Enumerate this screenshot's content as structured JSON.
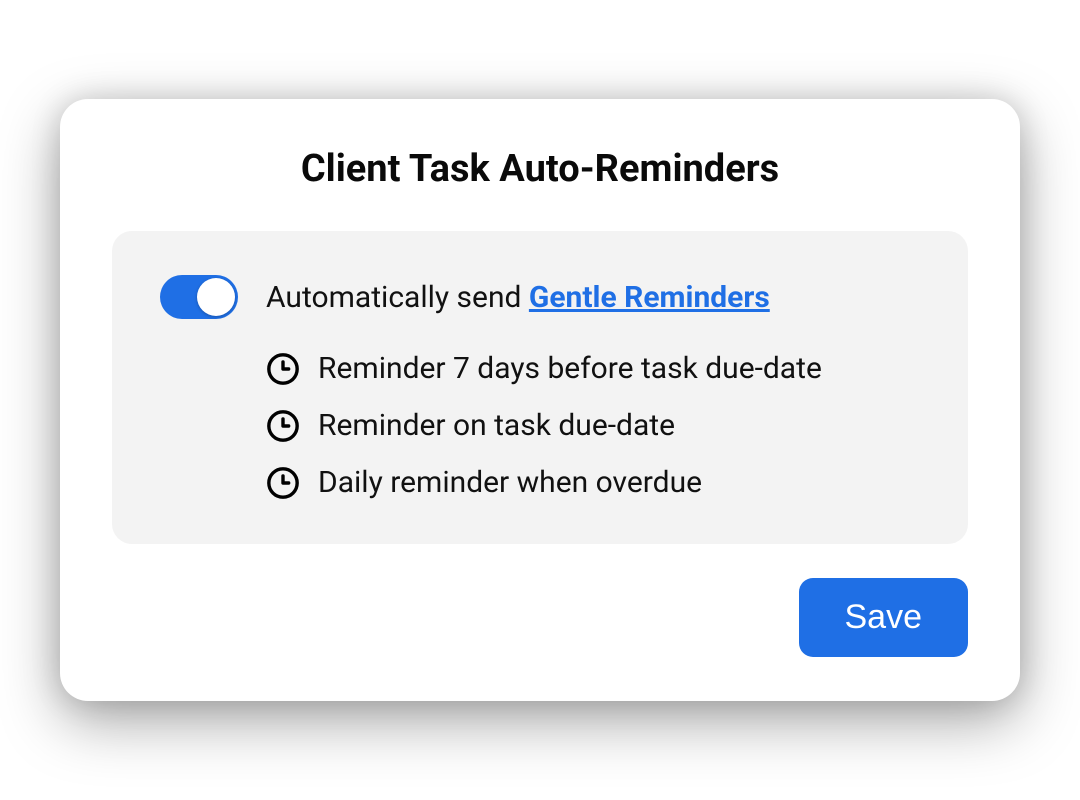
{
  "title": "Client Task Auto-Reminders",
  "toggle": {
    "on": true,
    "label_prefix": "Automatically send ",
    "link_text": "Gentle Reminders"
  },
  "reminders": [
    "Reminder 7 days before task due-date",
    "Reminder on task due-date",
    "Daily reminder when overdue"
  ],
  "save_label": "Save",
  "colors": {
    "accent": "#1f6fe5",
    "panel_bg": "#f3f3f3"
  }
}
